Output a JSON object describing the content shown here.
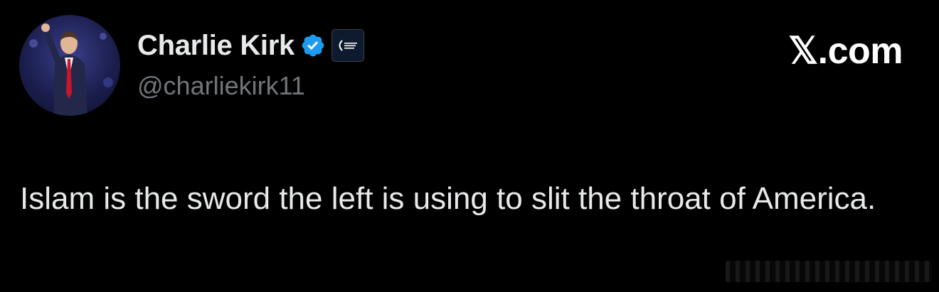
{
  "author": {
    "display_name": "Charlie Kirk",
    "handle": "@charliekirk11",
    "verified": true,
    "affiliate_badge": "Turning Point USA logo badge"
  },
  "brand": {
    "domain": "𝕏.com"
  },
  "tweet": {
    "text": "Islam is the sword the left is using to slit the throat of America."
  },
  "colors": {
    "background": "#000000",
    "text_primary": "#e7e9ea",
    "text_secondary": "#71767b",
    "verified_blue": "#1d9bf0"
  },
  "icons": {
    "avatar": "avatar-photo",
    "verified": "verified-badge-icon",
    "affiliate": "affiliate-badge-icon",
    "brand": "x-logo-icon"
  }
}
